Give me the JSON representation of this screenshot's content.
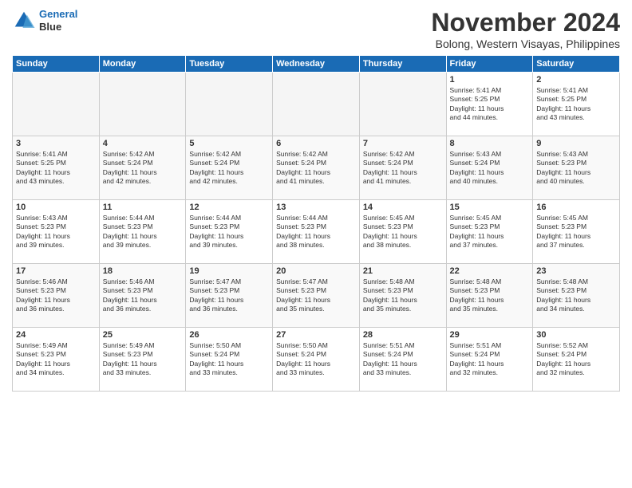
{
  "logo": {
    "line1": "General",
    "line2": "Blue"
  },
  "title": "November 2024",
  "subtitle": "Bolong, Western Visayas, Philippines",
  "days_of_week": [
    "Sunday",
    "Monday",
    "Tuesday",
    "Wednesday",
    "Thursday",
    "Friday",
    "Saturday"
  ],
  "weeks": [
    [
      {
        "day": "",
        "info": ""
      },
      {
        "day": "",
        "info": ""
      },
      {
        "day": "",
        "info": ""
      },
      {
        "day": "",
        "info": ""
      },
      {
        "day": "",
        "info": ""
      },
      {
        "day": "1",
        "info": "Sunrise: 5:41 AM\nSunset: 5:25 PM\nDaylight: 11 hours\nand 44 minutes."
      },
      {
        "day": "2",
        "info": "Sunrise: 5:41 AM\nSunset: 5:25 PM\nDaylight: 11 hours\nand 43 minutes."
      }
    ],
    [
      {
        "day": "3",
        "info": "Sunrise: 5:41 AM\nSunset: 5:25 PM\nDaylight: 11 hours\nand 43 minutes."
      },
      {
        "day": "4",
        "info": "Sunrise: 5:42 AM\nSunset: 5:24 PM\nDaylight: 11 hours\nand 42 minutes."
      },
      {
        "day": "5",
        "info": "Sunrise: 5:42 AM\nSunset: 5:24 PM\nDaylight: 11 hours\nand 42 minutes."
      },
      {
        "day": "6",
        "info": "Sunrise: 5:42 AM\nSunset: 5:24 PM\nDaylight: 11 hours\nand 41 minutes."
      },
      {
        "day": "7",
        "info": "Sunrise: 5:42 AM\nSunset: 5:24 PM\nDaylight: 11 hours\nand 41 minutes."
      },
      {
        "day": "8",
        "info": "Sunrise: 5:43 AM\nSunset: 5:24 PM\nDaylight: 11 hours\nand 40 minutes."
      },
      {
        "day": "9",
        "info": "Sunrise: 5:43 AM\nSunset: 5:23 PM\nDaylight: 11 hours\nand 40 minutes."
      }
    ],
    [
      {
        "day": "10",
        "info": "Sunrise: 5:43 AM\nSunset: 5:23 PM\nDaylight: 11 hours\nand 39 minutes."
      },
      {
        "day": "11",
        "info": "Sunrise: 5:44 AM\nSunset: 5:23 PM\nDaylight: 11 hours\nand 39 minutes."
      },
      {
        "day": "12",
        "info": "Sunrise: 5:44 AM\nSunset: 5:23 PM\nDaylight: 11 hours\nand 39 minutes."
      },
      {
        "day": "13",
        "info": "Sunrise: 5:44 AM\nSunset: 5:23 PM\nDaylight: 11 hours\nand 38 minutes."
      },
      {
        "day": "14",
        "info": "Sunrise: 5:45 AM\nSunset: 5:23 PM\nDaylight: 11 hours\nand 38 minutes."
      },
      {
        "day": "15",
        "info": "Sunrise: 5:45 AM\nSunset: 5:23 PM\nDaylight: 11 hours\nand 37 minutes."
      },
      {
        "day": "16",
        "info": "Sunrise: 5:45 AM\nSunset: 5:23 PM\nDaylight: 11 hours\nand 37 minutes."
      }
    ],
    [
      {
        "day": "17",
        "info": "Sunrise: 5:46 AM\nSunset: 5:23 PM\nDaylight: 11 hours\nand 36 minutes."
      },
      {
        "day": "18",
        "info": "Sunrise: 5:46 AM\nSunset: 5:23 PM\nDaylight: 11 hours\nand 36 minutes."
      },
      {
        "day": "19",
        "info": "Sunrise: 5:47 AM\nSunset: 5:23 PM\nDaylight: 11 hours\nand 36 minutes."
      },
      {
        "day": "20",
        "info": "Sunrise: 5:47 AM\nSunset: 5:23 PM\nDaylight: 11 hours\nand 35 minutes."
      },
      {
        "day": "21",
        "info": "Sunrise: 5:48 AM\nSunset: 5:23 PM\nDaylight: 11 hours\nand 35 minutes."
      },
      {
        "day": "22",
        "info": "Sunrise: 5:48 AM\nSunset: 5:23 PM\nDaylight: 11 hours\nand 35 minutes."
      },
      {
        "day": "23",
        "info": "Sunrise: 5:48 AM\nSunset: 5:23 PM\nDaylight: 11 hours\nand 34 minutes."
      }
    ],
    [
      {
        "day": "24",
        "info": "Sunrise: 5:49 AM\nSunset: 5:23 PM\nDaylight: 11 hours\nand 34 minutes."
      },
      {
        "day": "25",
        "info": "Sunrise: 5:49 AM\nSunset: 5:23 PM\nDaylight: 11 hours\nand 33 minutes."
      },
      {
        "day": "26",
        "info": "Sunrise: 5:50 AM\nSunset: 5:24 PM\nDaylight: 11 hours\nand 33 minutes."
      },
      {
        "day": "27",
        "info": "Sunrise: 5:50 AM\nSunset: 5:24 PM\nDaylight: 11 hours\nand 33 minutes."
      },
      {
        "day": "28",
        "info": "Sunrise: 5:51 AM\nSunset: 5:24 PM\nDaylight: 11 hours\nand 33 minutes."
      },
      {
        "day": "29",
        "info": "Sunrise: 5:51 AM\nSunset: 5:24 PM\nDaylight: 11 hours\nand 32 minutes."
      },
      {
        "day": "30",
        "info": "Sunrise: 5:52 AM\nSunset: 5:24 PM\nDaylight: 11 hours\nand 32 minutes."
      }
    ]
  ]
}
